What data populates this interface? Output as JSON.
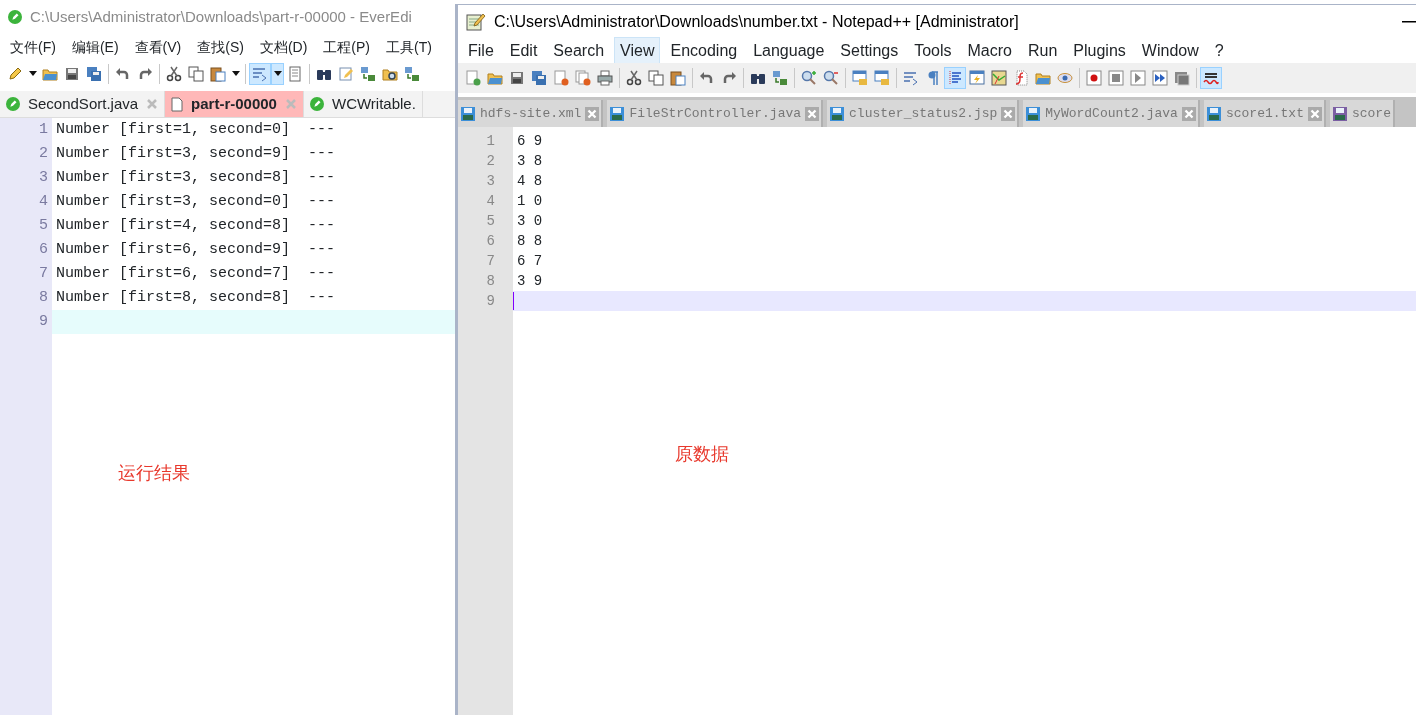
{
  "left_window": {
    "title": "C:\\Users\\Administrator\\Downloads\\part-r-00000 - EverEdi",
    "menu": [
      {
        "label": "文件(F)",
        "selected": false
      },
      {
        "label": "编辑(E)",
        "selected": false
      },
      {
        "label": "查看(V)",
        "selected": false
      },
      {
        "label": "查找(S)",
        "selected": false
      },
      {
        "label": "文档(D)",
        "selected": false
      },
      {
        "label": "工程(P)",
        "selected": false
      },
      {
        "label": "工具(T)",
        "selected": false
      }
    ],
    "toolbar": [
      {
        "kind": "pencil",
        "on": false
      },
      {
        "kind": "caret",
        "on": false
      },
      {
        "kind": "folder",
        "on": false
      },
      {
        "kind": "save",
        "on": false
      },
      {
        "kind": "saveall",
        "on": false
      },
      {
        "kind": "separator"
      },
      {
        "kind": "undo",
        "on": false
      },
      {
        "kind": "redo",
        "on": false
      },
      {
        "kind": "separator"
      },
      {
        "kind": "scissors",
        "on": false
      },
      {
        "kind": "copy",
        "on": false
      },
      {
        "kind": "paste",
        "on": false
      },
      {
        "kind": "caret",
        "on": false
      },
      {
        "kind": "separator"
      },
      {
        "kind": "wrap",
        "on": true
      },
      {
        "kind": "caret",
        "on": true
      },
      {
        "kind": "document",
        "on": false
      },
      {
        "kind": "separator"
      },
      {
        "kind": "binoculars",
        "on": false
      },
      {
        "kind": "edit",
        "on": false
      },
      {
        "kind": "replace",
        "on": false
      },
      {
        "kind": "foldersearch",
        "on": false
      },
      {
        "kind": "replace",
        "on": false
      }
    ],
    "tabs": [
      {
        "label": "SecondSort.java",
        "selected": false,
        "kind": "code"
      },
      {
        "label": "part-r-00000",
        "selected": true,
        "kind": "text"
      },
      {
        "label": "WCWritable.",
        "selected": false,
        "kind": "code"
      }
    ],
    "lines": [
      {
        "number": "1",
        "text": "Number [first=1, second=0]  ---",
        "current": false
      },
      {
        "number": "2",
        "text": "Number [first=3, second=9]  ---",
        "current": false
      },
      {
        "number": "3",
        "text": "Number [first=3, second=8]  ---",
        "current": false
      },
      {
        "number": "4",
        "text": "Number [first=3, second=0]  ---",
        "current": false
      },
      {
        "number": "5",
        "text": "Number [first=4, second=8]  ---",
        "current": false
      },
      {
        "number": "6",
        "text": "Number [first=6, second=9]  ---",
        "current": false
      },
      {
        "number": "7",
        "text": "Number [first=6, second=7]  ---",
        "current": false
      },
      {
        "number": "8",
        "text": "Number [first=8, second=8]  ---",
        "current": false
      },
      {
        "number": "9",
        "current": true
      }
    ],
    "annotation": "运行结果"
  },
  "right_window": {
    "title": "C:\\Users\\Administrator\\Downloads\\number.txt - Notepad++ [Administrator]",
    "menu": [
      {
        "label": "File",
        "selected": false
      },
      {
        "label": "Edit",
        "selected": false
      },
      {
        "label": "Search",
        "selected": false
      },
      {
        "label": "View",
        "selected": true
      },
      {
        "label": "Encoding",
        "selected": false
      },
      {
        "label": "Language",
        "selected": false
      },
      {
        "label": "Settings",
        "selected": false
      },
      {
        "label": "Tools",
        "selected": false
      },
      {
        "label": "Macro",
        "selected": false
      },
      {
        "label": "Run",
        "selected": false
      },
      {
        "label": "Plugins",
        "selected": false
      },
      {
        "label": "Window",
        "selected": false
      },
      {
        "label": "?",
        "selected": false
      }
    ],
    "toolbar": [
      {
        "kind": "newfile",
        "on": false
      },
      {
        "kind": "folder",
        "on": false
      },
      {
        "kind": "save",
        "on": false
      },
      {
        "kind": "saveall",
        "on": false
      },
      {
        "kind": "closefile",
        "on": false
      },
      {
        "kind": "closeall",
        "on": false
      },
      {
        "kind": "printer",
        "on": false
      },
      {
        "kind": "separator"
      },
      {
        "kind": "scissors",
        "on": false
      },
      {
        "kind": "copy",
        "on": false
      },
      {
        "kind": "paste",
        "on": false
      },
      {
        "kind": "separator"
      },
      {
        "kind": "undo",
        "on": false
      },
      {
        "kind": "redo",
        "on": false
      },
      {
        "kind": "separator"
      },
      {
        "kind": "binoculars",
        "on": false
      },
      {
        "kind": "replace",
        "on": false
      },
      {
        "kind": "separator"
      },
      {
        "kind": "zoomin",
        "on": false
      },
      {
        "kind": "zoomout",
        "on": false
      },
      {
        "kind": "separator"
      },
      {
        "kind": "lockwindow",
        "on": false
      },
      {
        "kind": "lockwindow",
        "on": false
      },
      {
        "kind": "separator"
      },
      {
        "kind": "wrap",
        "on": false
      },
      {
        "kind": "pilcrow",
        "on": false
      },
      {
        "kind": "indentguide",
        "on": true
      },
      {
        "kind": "lightning",
        "on": false
      },
      {
        "kind": "map",
        "on": false
      },
      {
        "kind": "function",
        "on": false
      },
      {
        "kind": "folder",
        "on": false
      },
      {
        "kind": "eye",
        "on": false
      },
      {
        "kind": "separator"
      },
      {
        "kind": "record",
        "on": false
      },
      {
        "kind": "stop",
        "on": false
      },
      {
        "kind": "play",
        "on": false
      },
      {
        "kind": "fastforward",
        "on": false
      },
      {
        "kind": "macrolist",
        "on": false
      },
      {
        "kind": "separator"
      },
      {
        "kind": "spellcheck",
        "on": true
      }
    ],
    "tabs": [
      {
        "label": "hdfs-site.xml",
        "color": "#3c8fd8"
      },
      {
        "label": "FileStrController.java",
        "color": "#3c8fd8"
      },
      {
        "label": "cluster_status2.jsp",
        "color": "#3c8fd8"
      },
      {
        "label": "MyWordCount2.java",
        "color": "#3c8fd8"
      },
      {
        "label": "score1.txt",
        "color": "#3c8fd8"
      },
      {
        "label": "score",
        "color": "#7b5fa3"
      }
    ],
    "lines": [
      {
        "number": "1",
        "text": "6 9",
        "current": false
      },
      {
        "number": "2",
        "text": "3 8",
        "current": false
      },
      {
        "number": "3",
        "text": "4 8",
        "current": false
      },
      {
        "number": "4",
        "text": "1 0",
        "current": false
      },
      {
        "number": "5",
        "text": "3 0",
        "current": false
      },
      {
        "number": "6",
        "text": "8 8",
        "current": false
      },
      {
        "number": "7",
        "text": "6 7",
        "current": false
      },
      {
        "number": "8",
        "text": "3 9",
        "current": false
      },
      {
        "number": "9",
        "current": true
      }
    ],
    "annotation": "原数据"
  }
}
